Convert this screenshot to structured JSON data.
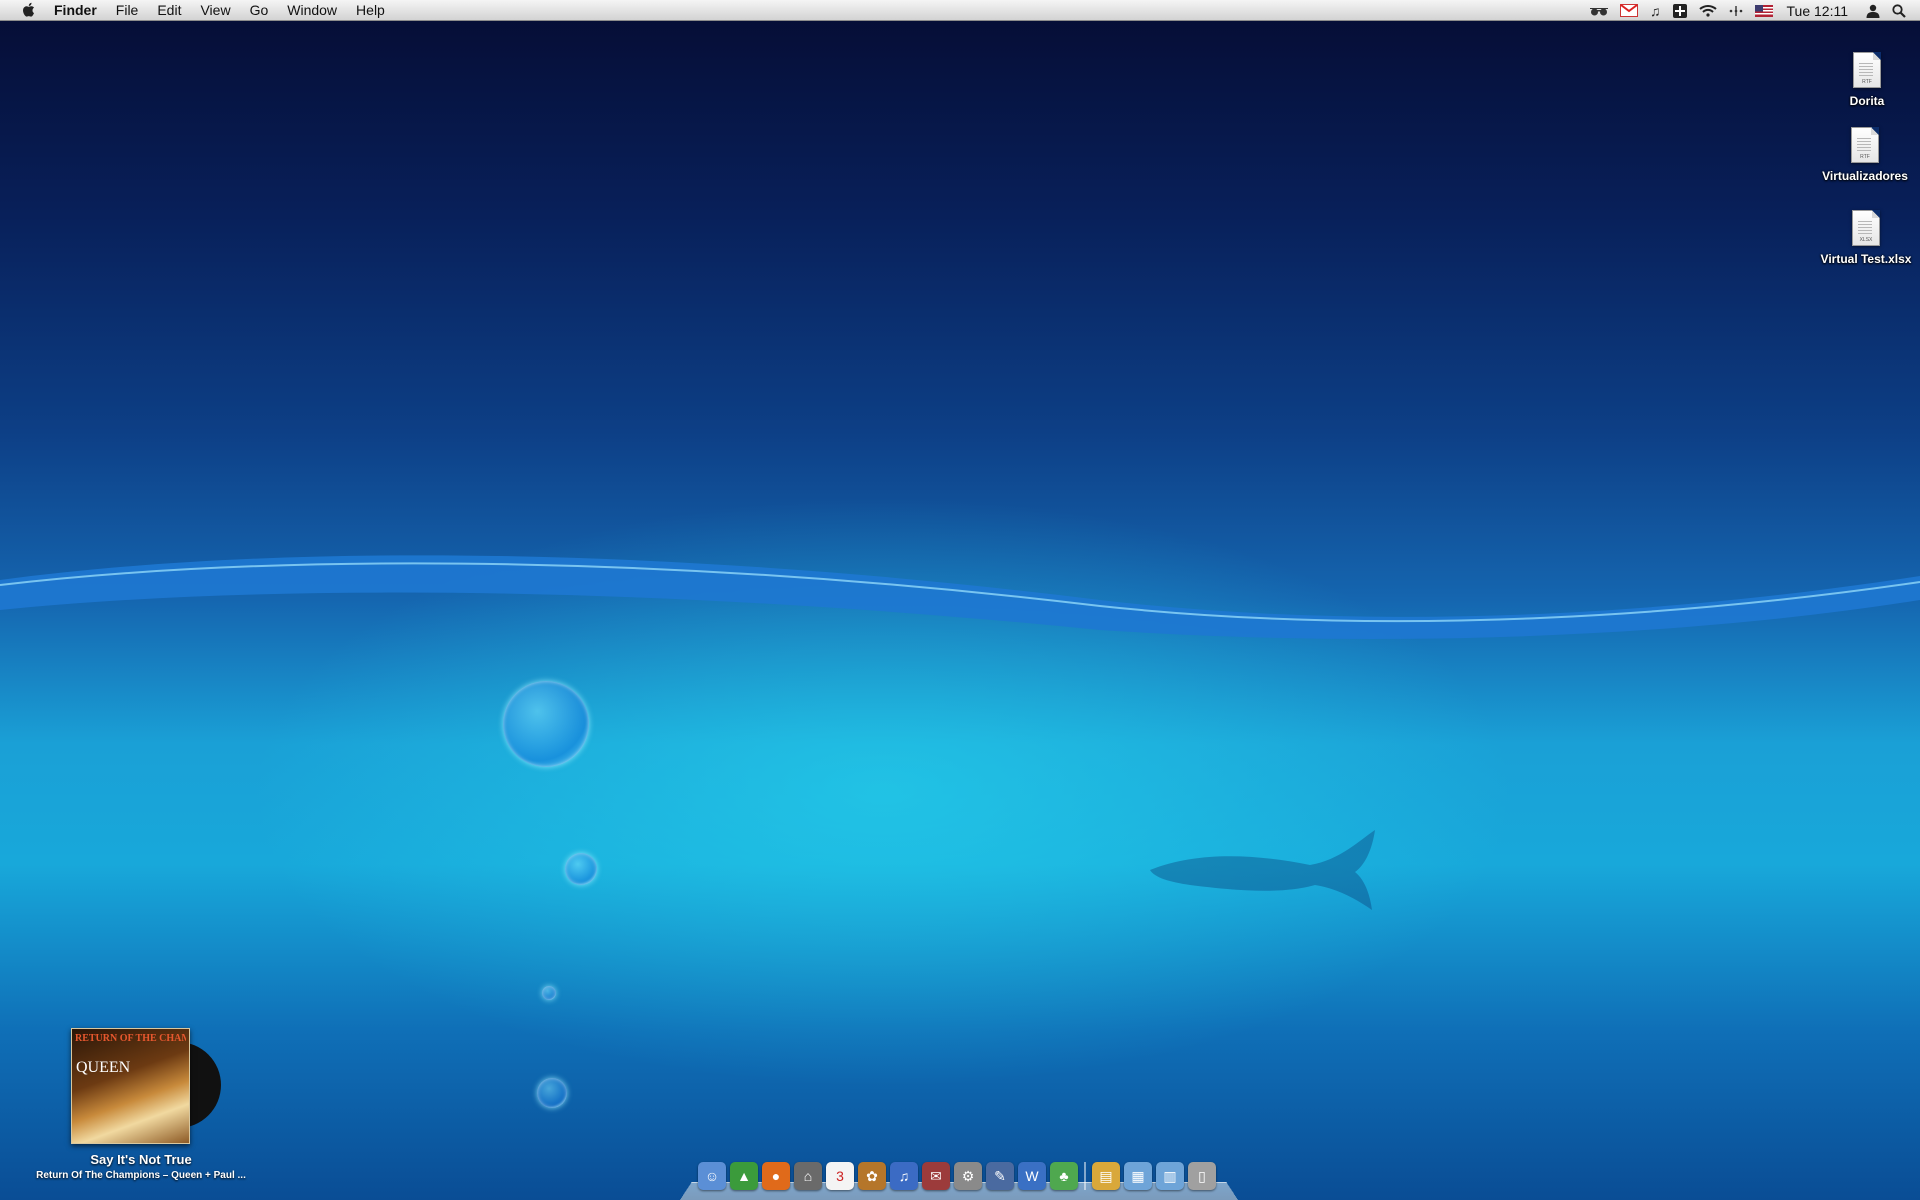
{
  "menubar": {
    "app_name": "Finder",
    "menus": [
      "File",
      "Edit",
      "View",
      "Go",
      "Window",
      "Help"
    ],
    "clock": "Tue 12:11",
    "tray_icons": [
      "glasses-icon",
      "gmail-icon",
      "music-note-icon",
      "dashboard-icon",
      "wifi-icon",
      "bluetooth-dots-icon",
      "flag-icon",
      "user-icon",
      "spotlight-icon"
    ]
  },
  "desktop": {
    "icons": [
      {
        "label": "Dorita",
        "ext": "RTF"
      },
      {
        "label": "Virtualizadores",
        "ext": "RTF"
      },
      {
        "label": "Virtual Test.xlsx",
        "ext": "XLSX"
      }
    ]
  },
  "now_playing": {
    "song": "Say It's Not True",
    "album_artist": "Return Of The Champions – Queen + Paul ...",
    "cover_title": "RETURN OF THE CHAMPIONS",
    "cover_band": "QUEEN"
  },
  "dock": {
    "items": [
      {
        "name": "finder-icon",
        "glyph": "☺",
        "color": "#5b8fd6"
      },
      {
        "name": "app-green-icon",
        "glyph": "▲",
        "color": "#3b9b3b"
      },
      {
        "name": "firefox-icon",
        "glyph": "●",
        "color": "#e06a1a"
      },
      {
        "name": "app-bank-icon",
        "glyph": "⌂",
        "color": "#6a6a6a"
      },
      {
        "name": "calendar-icon",
        "glyph": "3",
        "color": "#f4f4f4"
      },
      {
        "name": "iphoto-icon",
        "glyph": "✿",
        "color": "#b5762a"
      },
      {
        "name": "itunes-icon",
        "glyph": "♫",
        "color": "#3b6bc4"
      },
      {
        "name": "addressbook-icon",
        "glyph": "✉",
        "color": "#9c3b3b"
      },
      {
        "name": "system-preferences-icon",
        "glyph": "⚙",
        "color": "#8a8a8a"
      },
      {
        "name": "script-editor-icon",
        "glyph": "✎",
        "color": "#4a6aa0"
      },
      {
        "name": "word-icon",
        "glyph": "W",
        "color": "#3a70c4"
      },
      {
        "name": "plant-icon",
        "glyph": "♣",
        "color": "#4fa84f"
      }
    ],
    "stack_items": [
      {
        "name": "documents-stack-icon",
        "glyph": "▤",
        "color": "#d9a83a"
      },
      {
        "name": "applications-folder-icon",
        "glyph": "▦",
        "color": "#6ea4d8"
      },
      {
        "name": "downloads-folder-icon",
        "glyph": "▥",
        "color": "#6ea4d8"
      },
      {
        "name": "trash-icon",
        "glyph": "▯",
        "color": "#a0a0a0"
      }
    ]
  }
}
